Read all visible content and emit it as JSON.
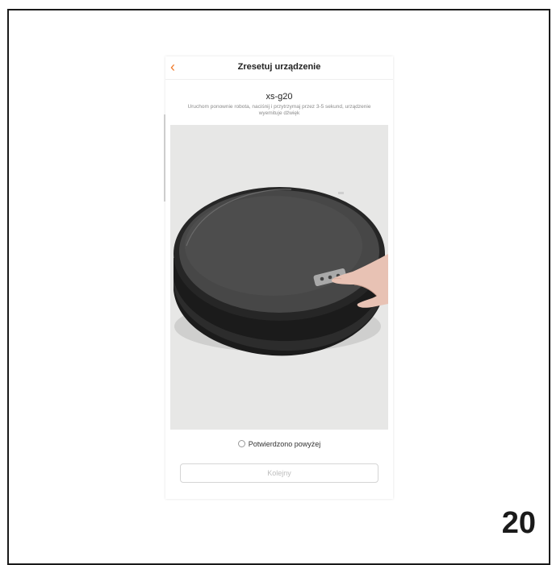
{
  "screen": {
    "title": "Zresetuj urządzenie",
    "device_name": "xs-g20",
    "instruction": "Uruchom ponownie robota, naciśnij i przytrzymaj przez 3-5 sekund, urządzenie wyemituje dźwięk",
    "confirm_label": "Potwierdzono powyżej",
    "next_button_label": "Kolejny"
  },
  "page_number": "20",
  "colors": {
    "accent": "#f07a2a",
    "photo_background": "#e7e7e6",
    "disabled_button_text": "#bdbdbd"
  },
  "icons": {
    "back": "chevron-left-icon",
    "radio": "radio-unchecked-icon"
  }
}
